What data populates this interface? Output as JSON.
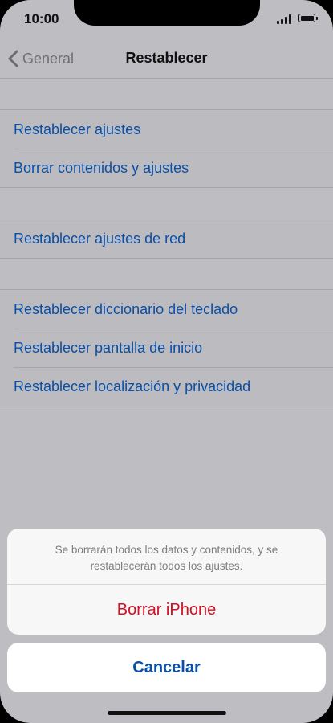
{
  "status_bar": {
    "time": "10:00",
    "signal_icon": "cellular-signal-icon",
    "battery_icon": "battery-icon"
  },
  "nav": {
    "back_label": "General",
    "back_icon": "chevron-left-icon",
    "title": "Restablecer"
  },
  "groups": [
    {
      "items": [
        {
          "label": "Restablecer ajustes"
        },
        {
          "label": "Borrar contenidos y ajustes"
        }
      ]
    },
    {
      "items": [
        {
          "label": "Restablecer ajustes de red"
        }
      ]
    },
    {
      "items": [
        {
          "label": "Restablecer diccionario del teclado"
        },
        {
          "label": "Restablecer pantalla de inicio"
        },
        {
          "label": "Restablecer localización y privacidad"
        }
      ]
    }
  ],
  "action_sheet": {
    "message": "Se borrarán todos los datos y contenidos, y se restablecerán todos los ajustes.",
    "destructive_label": "Borrar iPhone",
    "cancel_label": "Cancelar"
  },
  "colors": {
    "link_blue": "#0a4fa8",
    "destructive_red": "#d10f23",
    "dimmed_background": "#bdbdc2"
  }
}
